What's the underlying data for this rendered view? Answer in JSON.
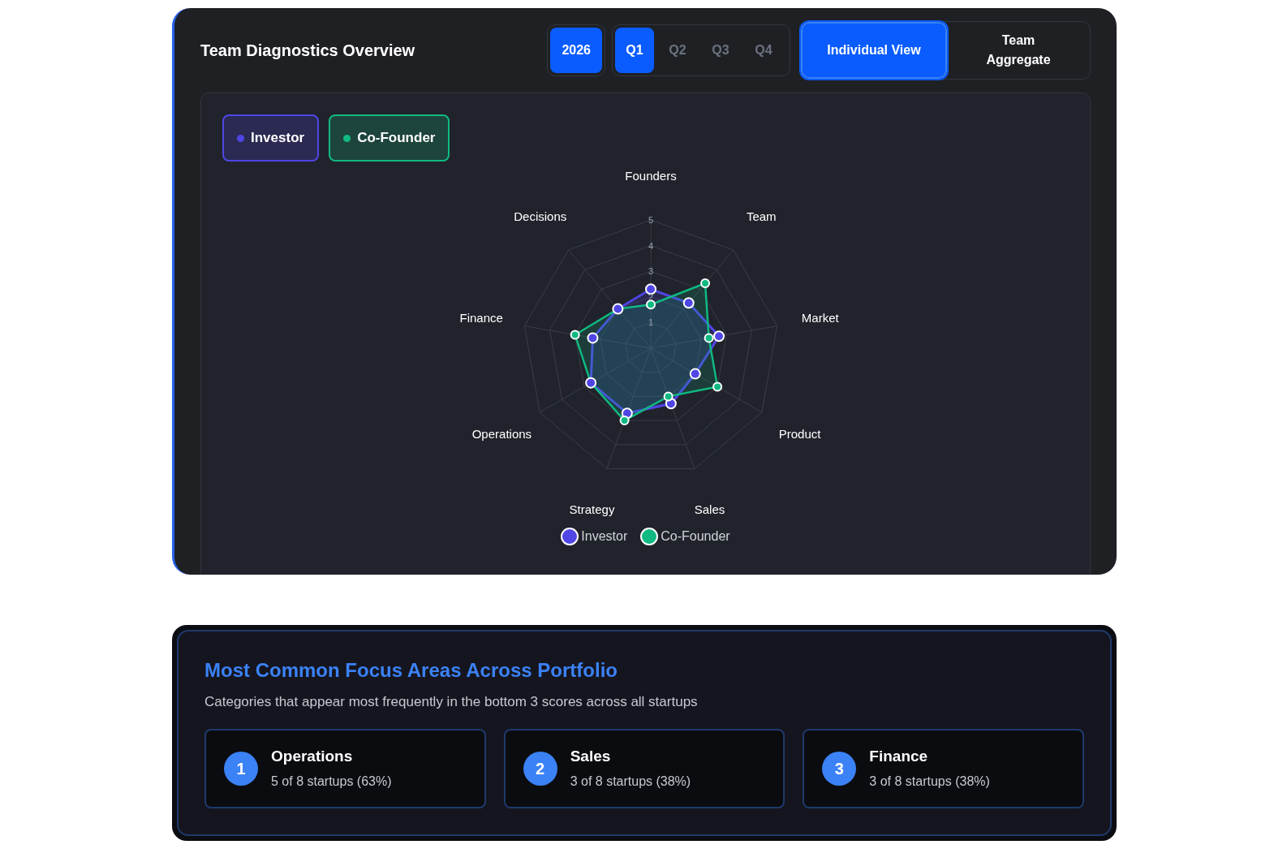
{
  "header": {
    "title": "Team Diagnostics Overview",
    "years": [
      {
        "label": "2026",
        "selected": true
      }
    ],
    "quarters": [
      {
        "label": "Q1",
        "selected": true
      },
      {
        "label": "Q2",
        "selected": false
      },
      {
        "label": "Q3",
        "selected": false
      },
      {
        "label": "Q4",
        "selected": false
      }
    ],
    "views": [
      {
        "label": "Individual View",
        "selected": true
      },
      {
        "label": "Team Aggregate",
        "selected": false
      }
    ]
  },
  "filters": [
    {
      "label": "Investor",
      "color": "#4f46e5",
      "on": true
    },
    {
      "label": "Co-Founder",
      "color": "#10b981",
      "on": true
    }
  ],
  "chart_data": {
    "type": "radar",
    "categories": [
      "Founders",
      "Team",
      "Market",
      "Product",
      "Sales",
      "Strategy",
      "Operations",
      "Finance",
      "Decisions"
    ],
    "yticks": [
      1,
      2,
      3,
      4,
      5
    ],
    "ylim": [
      0,
      5
    ],
    "series": [
      {
        "name": "Investor",
        "color": "#4f46e5",
        "values": [
          2.3,
          2.3,
          2.7,
          2.0,
          2.3,
          2.7,
          2.7,
          2.3,
          2.0
        ]
      },
      {
        "name": "Co-Founder",
        "color": "#10b981",
        "values": [
          1.7,
          3.3,
          2.3,
          3.0,
          2.0,
          3.0,
          2.7,
          3.0,
          2.0
        ]
      }
    ]
  },
  "focus": {
    "title": "Most Common Focus Areas Across Portfolio",
    "subtitle": "Categories that appear most frequently in the bottom 3 scores across all startups",
    "items": [
      {
        "rank": "1",
        "name": "Operations",
        "detail": "5 of 8 startups (63%)"
      },
      {
        "rank": "2",
        "name": "Sales",
        "detail": "3 of 8 startups (38%)"
      },
      {
        "rank": "3",
        "name": "Finance",
        "detail": "3 of 8 startups (38%)"
      }
    ]
  }
}
